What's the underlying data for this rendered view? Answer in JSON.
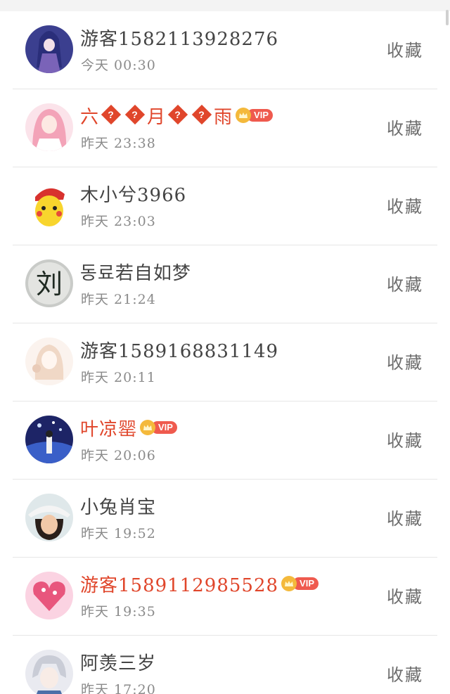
{
  "favorite_label": "收藏",
  "vip_label": "VIP",
  "visitors": [
    {
      "name": "游客15821139​28276",
      "time": "今天 00:30",
      "vip": false
    },
    {
      "name_parts": [
        "六",
        "?",
        "?",
        "月",
        "?",
        "?",
        "雨"
      ],
      "time": "昨天 23:38",
      "vip": true
    },
    {
      "name": "木小兮3966",
      "time": "昨天 23:03",
      "vip": false
    },
    {
      "name": "동료若自如梦",
      "time": "昨天 21:24",
      "vip": false
    },
    {
      "name": "游客15891688​31149",
      "time": "昨天 20:11",
      "vip": false
    },
    {
      "name": "叶凉罂",
      "time": "昨天 20:06",
      "vip": true
    },
    {
      "name": "小兔肖宝",
      "time": "昨天 19:52",
      "vip": false
    },
    {
      "name": "游客158911298​5528",
      "time": "昨天 19:35",
      "vip": true
    },
    {
      "name": "阿羡三岁",
      "time": "昨天 17:20",
      "vip": false
    }
  ],
  "colors": {
    "vip_name": "#e0462b",
    "normal_name": "#444444",
    "time": "#8a8a8a"
  }
}
